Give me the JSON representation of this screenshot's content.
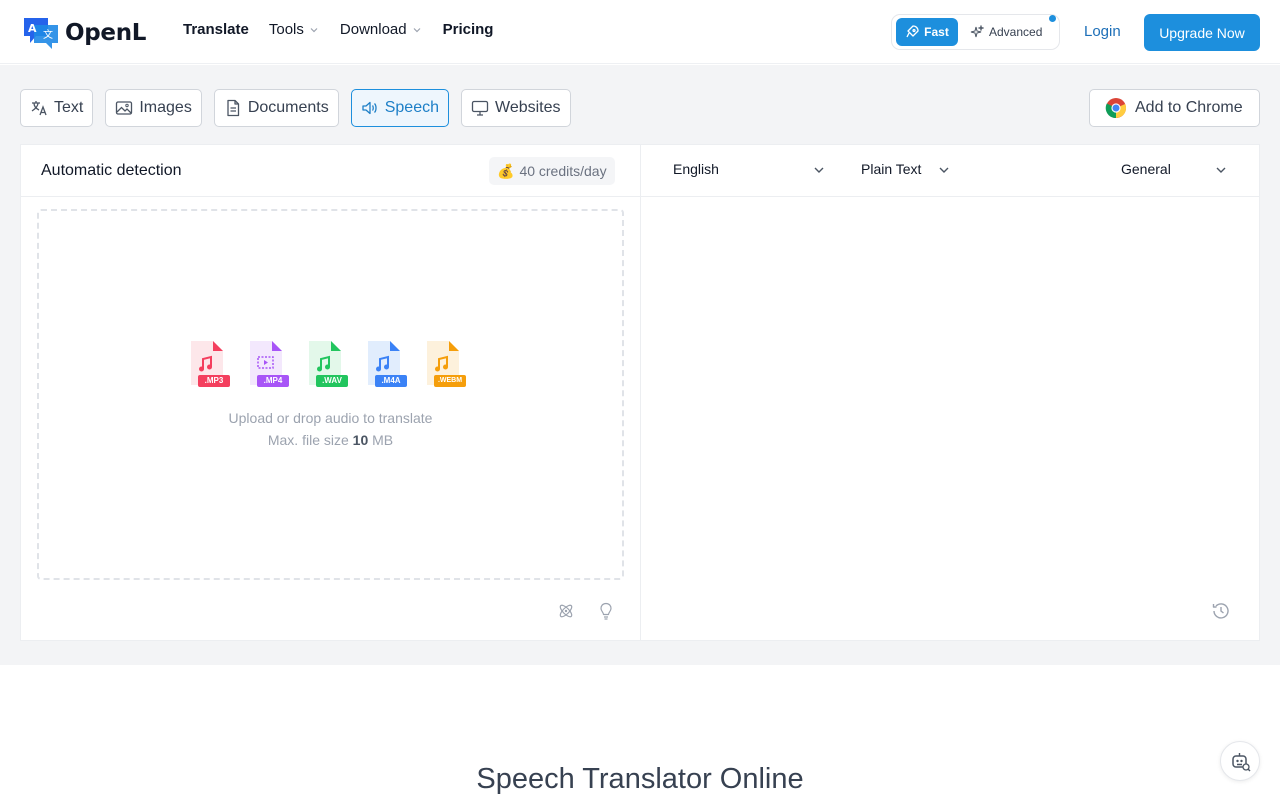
{
  "header": {
    "brand": "OpenL",
    "nav": [
      {
        "label": "Translate",
        "has_dropdown": false
      },
      {
        "label": "Tools",
        "has_dropdown": true
      },
      {
        "label": "Download",
        "has_dropdown": true
      },
      {
        "label": "Pricing",
        "has_dropdown": false
      }
    ],
    "mode_fast": "Fast",
    "mode_advanced": "Advanced",
    "login": "Login",
    "upgrade": "Upgrade Now"
  },
  "tabs": [
    {
      "label": "Text",
      "icon": "translate-icon",
      "active": false
    },
    {
      "label": "Images",
      "icon": "image-icon",
      "active": false
    },
    {
      "label": "Documents",
      "icon": "document-icon",
      "active": false
    },
    {
      "label": "Speech",
      "icon": "speaker-icon",
      "active": true
    },
    {
      "label": "Websites",
      "icon": "monitor-icon",
      "active": false
    }
  ],
  "add_to_chrome": "Add to Chrome",
  "source": {
    "language": "Automatic detection",
    "credits_emoji": "💰",
    "credits": "40 credits/day"
  },
  "target": {
    "language": "English",
    "format": "Plain Text",
    "domain": "General"
  },
  "upload": {
    "file_types": [
      {
        "label": ".MP3",
        "color": "#f43f5e"
      },
      {
        "label": ".MP4",
        "color": "#a855f7"
      },
      {
        "label": ".WAV",
        "color": "#22c55e"
      },
      {
        "label": ".M4A",
        "color": "#3b82f6"
      },
      {
        "label": ".WEBM",
        "color": "#f59e0b"
      }
    ],
    "instruction": "Upload or drop audio to translate",
    "size_prefix": "Max. file size",
    "size_value": "10",
    "size_unit": "MB"
  },
  "section_title": "Speech Translator Online",
  "colors": {
    "accent": "#1d8fdd",
    "background": "#f3f4f6"
  }
}
